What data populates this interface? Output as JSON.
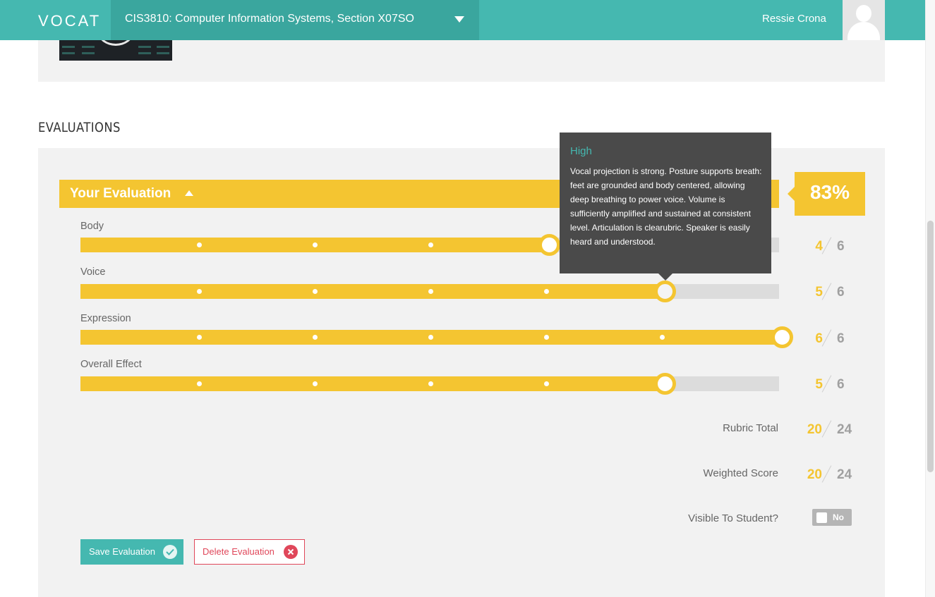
{
  "header": {
    "logo": "VOCAT",
    "course": "CIS3810: Computer Information Systems, Section X07SO",
    "user_name": "Ressie Crona"
  },
  "section_title": "EVALUATIONS",
  "evaluation": {
    "title": "Your Evaluation",
    "percent": "83%",
    "rows": [
      {
        "label": "Body",
        "score": "4",
        "max": "6",
        "level": 0.6667
      },
      {
        "label": "Voice",
        "score": "5",
        "max": "6",
        "level": 0.8333
      },
      {
        "label": "Expression",
        "score": "6",
        "max": "6",
        "level": 1.0
      },
      {
        "label": "Overall Effect",
        "score": "5",
        "max": "6",
        "level": 0.8333
      }
    ],
    "rubric_total": {
      "label": "Rubric Total",
      "score": "20",
      "max": "24"
    },
    "weighted_score": {
      "label": "Weighted Score",
      "score": "20",
      "max": "24"
    },
    "visible_to_student": {
      "label": "Visible To Student?",
      "value": "No"
    },
    "save_label": "Save Evaluation",
    "delete_label": "Delete Evaluation"
  },
  "tooltip": {
    "title": "High",
    "body": "Vocal projection is strong. Posture supports breath: feet are grounded and body centered, allowing deep breathing to power voice. Volume is sufficiently amplified and sustained at consistent level. Articulation is clearubric. Speaker is easily heard and understood."
  },
  "colors": {
    "brand_teal": "#45b8b0",
    "accent_yellow": "#f4c531",
    "danger_red": "#e0475a"
  }
}
